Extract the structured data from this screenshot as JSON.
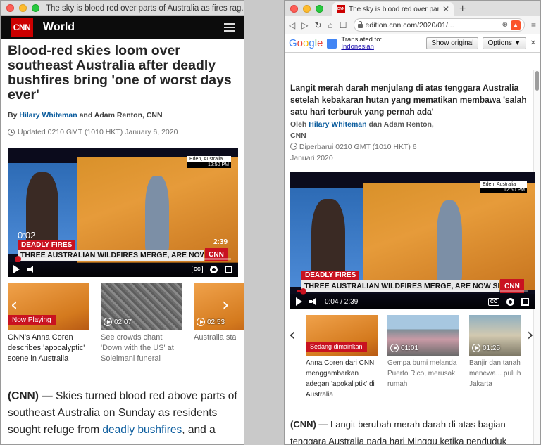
{
  "left_window": {
    "title": "The sky is blood red over parts of Australia as fires rag...",
    "logo": "CNN",
    "section": "World",
    "headline": "Blood-red skies loom over southeast Australia after deadly bushfires bring 'one of worst days ever'",
    "byline": {
      "prefix": "By",
      "author1": "Hilary Whiteman",
      "rest": "and Adam Renton, CNN"
    },
    "updated": "Updated 0210 GMT (1010 HKT) January 6, 2020",
    "video": {
      "location": "Eden, Australia",
      "time": "12:50 PM",
      "lower_third_red": "DEADLY FIRES",
      "lower_third": "THREE AUSTRALIAN WILDFIRES MERGE, ARE NOW SIZE OF MANHATTAN",
      "bug": "CNN",
      "elapsed": "0:02",
      "duration": "2:39",
      "cc": "CC",
      "progress": 0.013
    },
    "carousel": [
      {
        "badge": "Now Playing",
        "caption": "CNN's Anna Coren describes 'apocalyptic' scene in Australia"
      },
      {
        "duration": "02:07",
        "caption": "See crowds chant 'Down with the US' at Soleimani funeral"
      },
      {
        "duration": "02:53",
        "caption": "Australia sta... emergency ... in fire-hit re..."
      }
    ],
    "body": {
      "lead": "(CNN) —",
      "text1": " Skies turned blood red above parts of southeast Australia on Sunday as residents sought refuge from ",
      "link": "deadly bushfires",
      "text2": ", and a"
    }
  },
  "right_window": {
    "tab_title": "The sky is blood red over parts of",
    "tab_favicon": "CNN",
    "url": "edition.cnn.com/2020/01/...",
    "translate_bar": {
      "google": [
        "G",
        "o",
        "o",
        "g",
        "l",
        "e"
      ],
      "translated_to": "Translated to:",
      "language": "Indonesian",
      "show_original": "Show original",
      "options": "Options ▼"
    },
    "headline": "Langit merah darah menjulang di atas tenggara Australia setelah kebakaran hutan yang mematikan membawa 'salah satu hari terburuk yang pernah ada'",
    "byline": {
      "prefix": "Oleh",
      "author1": "Hilary Whiteman",
      "rest": "dan Adam Renton,",
      "line2": "CNN"
    },
    "updated": "Diperbarui 0210 GMT (1010 HKT) 6 Januari 2020",
    "video": {
      "location": "Eden, Australia",
      "time": "12:50 PM",
      "lower_third_red": "DEADLY FIRES",
      "lower_third": "THREE AUSTRALIAN WILDFIRES MERGE, ARE NOW SIZE OF MANHATTAN",
      "bug": "CNN",
      "time_display": "0:04 / 2:39",
      "cc": "CC",
      "progress": 0.025
    },
    "carousel": [
      {
        "badge": "Sedang dimainkan",
        "caption": "Anna Coren dari CNN menggambarkan adegan 'apokaliptik' di Australia"
      },
      {
        "duration": "01:01",
        "caption": "Gempa bumi melanda Puerto Rico, merusak rumah"
      },
      {
        "duration": "01:25",
        "caption": "Banjir dan tanah longsor menewa... puluhan orang d... Jakarta"
      }
    ],
    "body": {
      "lead": "(CNN) —",
      "text": " Langit berubah merah darah di atas bagian tenggara Australia pada hari Minggu ketika penduduk"
    }
  },
  "colors": {
    "cnn_red": "#cc0000",
    "link_blue": "#0c5d9e",
    "progress_red": "#c91220"
  }
}
